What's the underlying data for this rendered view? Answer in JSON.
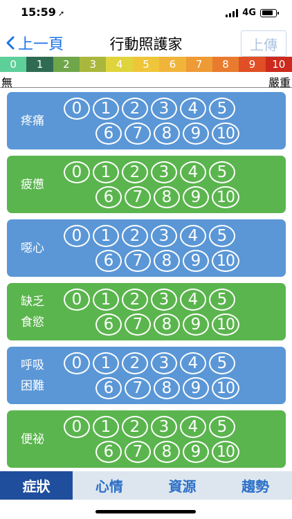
{
  "status": {
    "time": "15:59",
    "network": "4G"
  },
  "nav": {
    "back_label": "上一頁",
    "title": "行動照護家",
    "upload_label": "上傳"
  },
  "scale": {
    "items": [
      {
        "label": "0",
        "color": "#5fcf9a"
      },
      {
        "label": "1",
        "color": "#2f6b52"
      },
      {
        "label": "2",
        "color": "#6fa64a"
      },
      {
        "label": "3",
        "color": "#a9b83c"
      },
      {
        "label": "4",
        "color": "#e0d43c"
      },
      {
        "label": "5",
        "color": "#efc53a"
      },
      {
        "label": "6",
        "color": "#f1b43a"
      },
      {
        "label": "7",
        "color": "#ee9a35"
      },
      {
        "label": "8",
        "color": "#e97b2e"
      },
      {
        "label": "9",
        "color": "#e04f25"
      },
      {
        "label": "10",
        "color": "#cc2a1d"
      }
    ],
    "min_label": "無",
    "max_label": "嚴重"
  },
  "numbers": [
    "0",
    "1",
    "2",
    "3",
    "4",
    "5",
    "6",
    "7",
    "8",
    "9",
    "10"
  ],
  "symptoms": [
    {
      "lines": [
        "疼痛"
      ],
      "color": "blue"
    },
    {
      "lines": [
        "疲憊"
      ],
      "color": "green"
    },
    {
      "lines": [
        "噁心"
      ],
      "color": "blue"
    },
    {
      "lines": [
        "缺乏",
        "食慾"
      ],
      "color": "green"
    },
    {
      "lines": [
        "呼吸",
        "困難"
      ],
      "color": "blue"
    },
    {
      "lines": [
        "便祕"
      ],
      "color": "green"
    }
  ],
  "tabs": [
    {
      "label": "症狀",
      "active": true
    },
    {
      "label": "心情",
      "active": false
    },
    {
      "label": "資源",
      "active": false
    },
    {
      "label": "趨勢",
      "active": false
    }
  ]
}
